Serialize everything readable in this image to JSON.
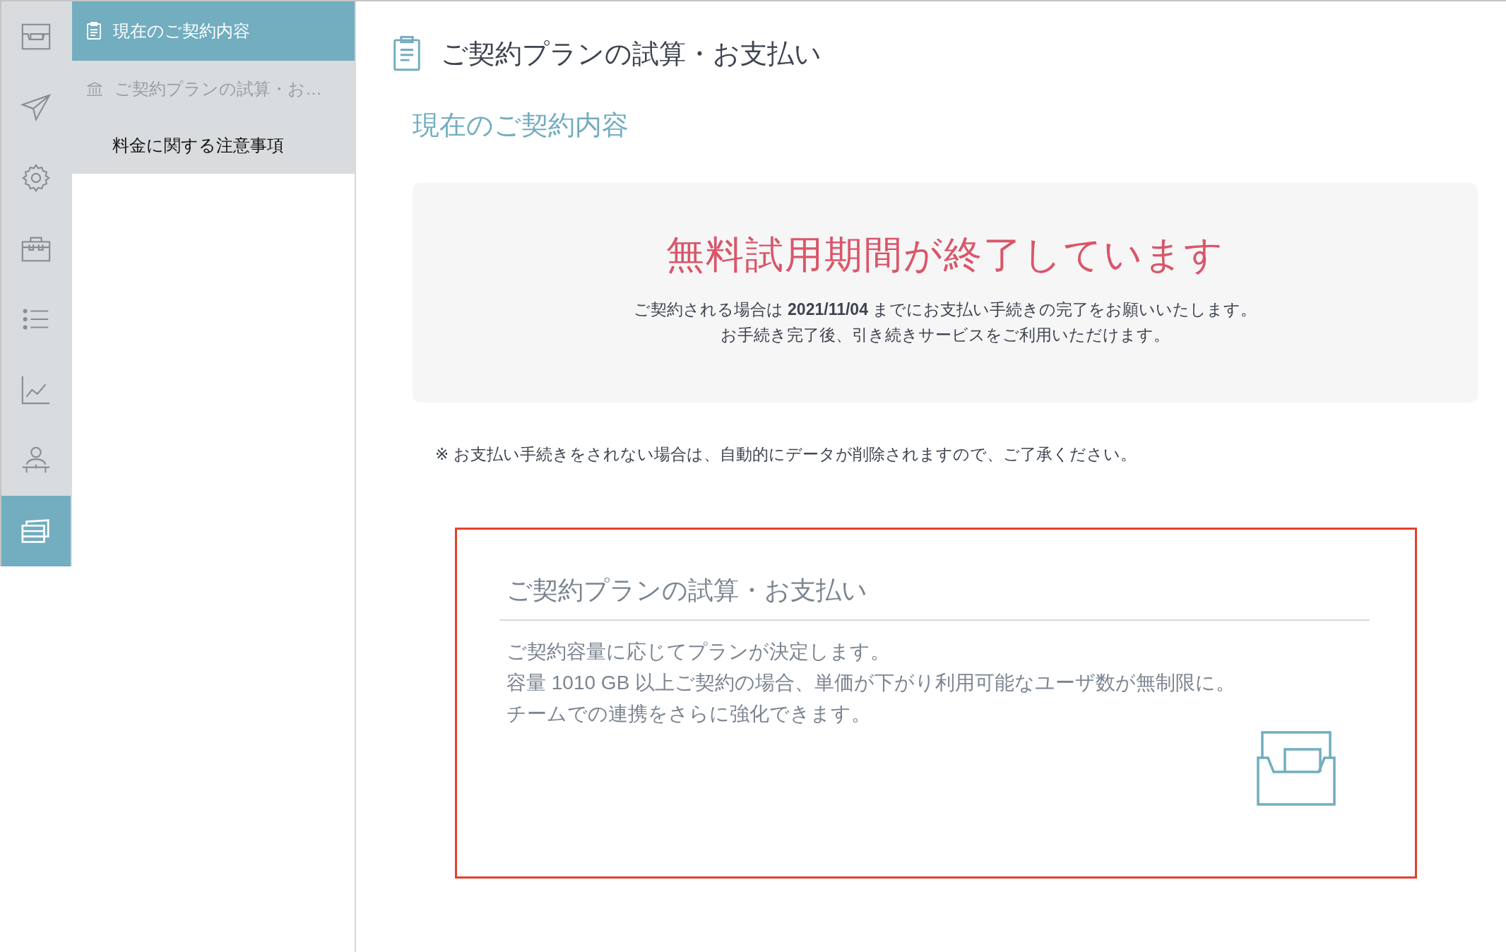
{
  "rail": [
    {
      "kind": "inbox",
      "selected": false
    },
    {
      "kind": "send",
      "selected": false
    },
    {
      "kind": "settings",
      "selected": false
    },
    {
      "kind": "toolbox",
      "selected": false
    },
    {
      "kind": "list",
      "selected": false
    },
    {
      "kind": "chart",
      "selected": false
    },
    {
      "kind": "user",
      "selected": false
    },
    {
      "kind": "cards",
      "selected": true
    }
  ],
  "sidebar": {
    "items": [
      {
        "kind": "document",
        "label": "現在のご契約内容",
        "selected": true,
        "disabled": false
      },
      {
        "kind": "bank",
        "label": "ご契約プランの試算・お…",
        "selected": false,
        "disabled": true
      },
      {
        "kind": "plain",
        "label": "料金に関する注意事項",
        "selected": false,
        "disabled": false
      }
    ]
  },
  "page": {
    "title": "ご契約プランの試算・お支払い",
    "section_title": "現在のご契約内容"
  },
  "notice": {
    "headline": "無料試用期間が終了しています",
    "lines": [
      "ご契約される場合は **2021/11/04** までにお支払い手続きの完了をお願いいたします。",
      "お手続き完了後、引き続きサービスをご利用いただけます。"
    ]
  },
  "note": "※ お支払い手続きをされない場合は、自動的にデータが削除されますので、ご了承ください。",
  "plan_box": {
    "title": "ご契約プランの試算・お支払い",
    "lines": [
      "ご契約容量に応じてプランが決定します。",
      "容量 1010 GB 以上ご契約の場合、単価が下がり利用可能なユーザ数が無制限に。",
      "チームでの連携をさらに強化できます。"
    ]
  }
}
